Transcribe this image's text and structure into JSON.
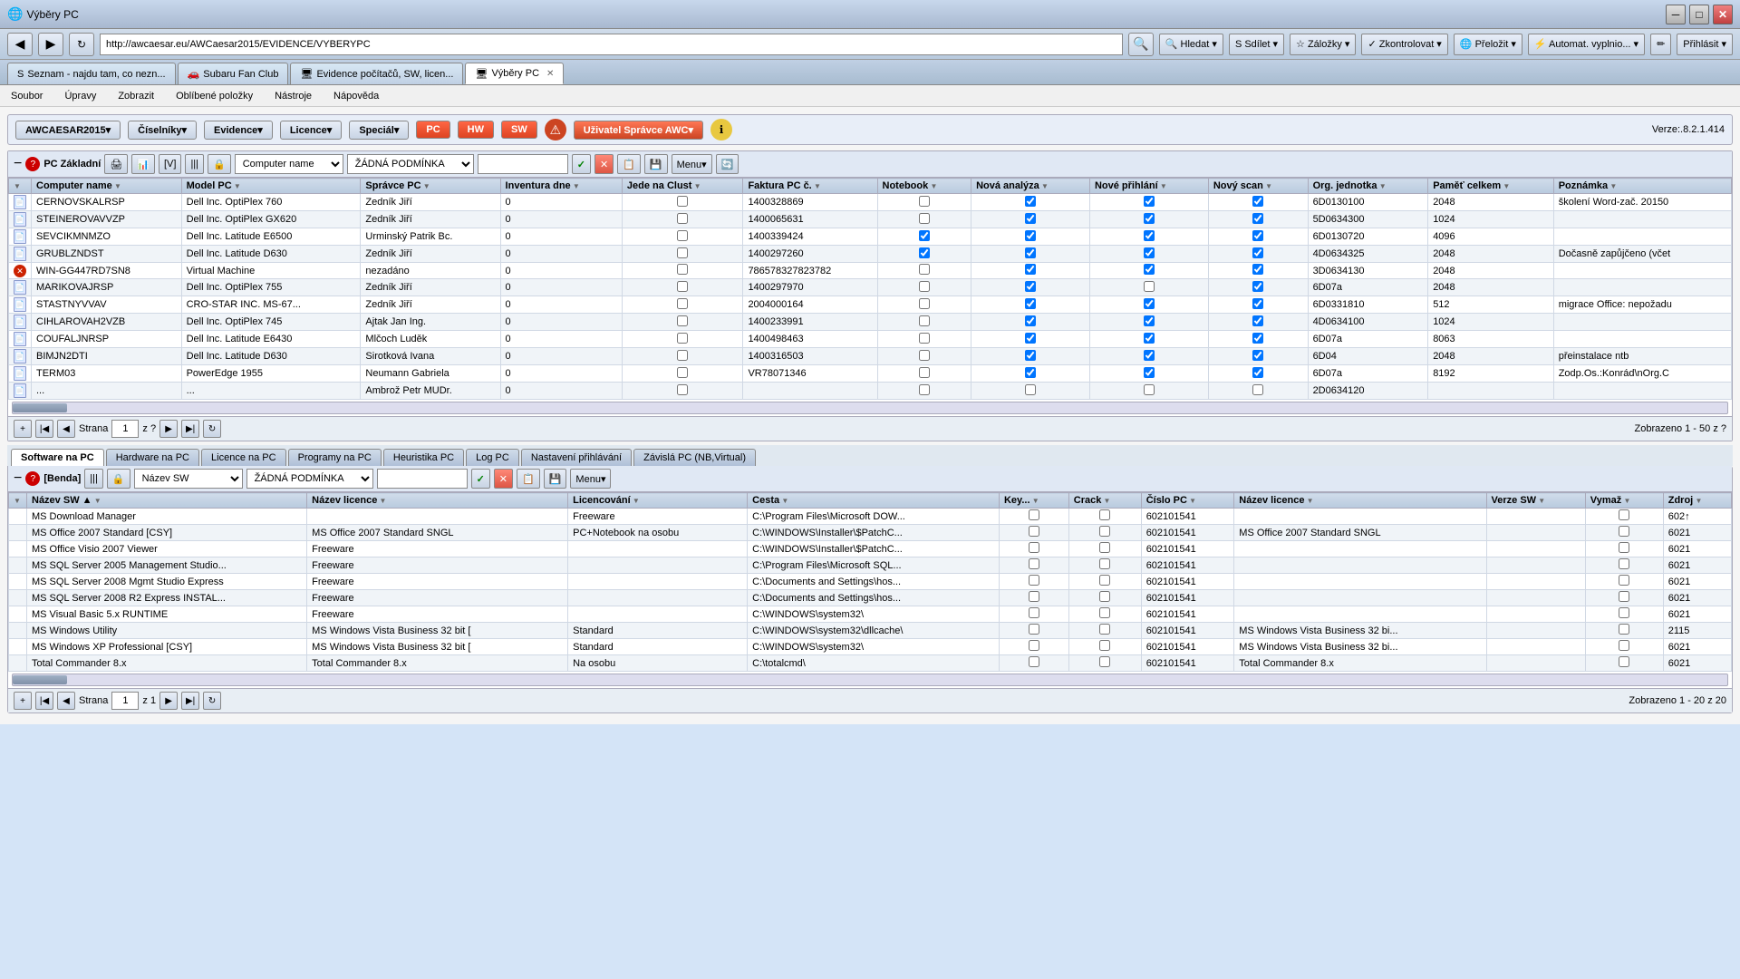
{
  "browser": {
    "titlebar": {
      "title": "Výběry PC"
    },
    "tabs": [
      {
        "label": "Seznam - najdu tam, co nezn...",
        "active": false
      },
      {
        "label": "Subaru Fan Club",
        "active": false
      },
      {
        "label": "Evidence počítačů, SW, licen...",
        "active": false
      },
      {
        "label": "Výběry PC",
        "active": true
      }
    ],
    "address": "http://awcaesar.eu/AWCaesar2015/EVIDENCE/VYBERYPC",
    "toolbar_items": [
      "Hledat ▾",
      "S Sdílet ▾",
      "☆ Záložky ▾",
      "✓ Zkontrolovat ▾",
      "Přeložit ▾",
      "Automat. vyplnio... ▾",
      "✏"
    ]
  },
  "menu_bar": [
    "Soubor",
    "Úpravy",
    "Zobrazit",
    "Oblíbené položky",
    "Nástroje",
    "Nápověda"
  ],
  "app_header": {
    "nav_items": [
      "AWCAESAR2015▾",
      "Číselníky▾",
      "Evidence▾",
      "Licence▾",
      "Speciál▾"
    ],
    "pc_label": "PC",
    "hw_label": "HW",
    "sw_label": "SW",
    "user_label": "Uživatel Správce AWC▾",
    "version_label": "Verze:.8.2.1.414"
  },
  "top_section": {
    "toolbar": {
      "icon_label": "PC Základní",
      "filter_field": "Computer name",
      "filter_condition": "ŽÁDNÁ PODMÍNKA",
      "menu_label": "Menu▾"
    },
    "columns": [
      "",
      "Computer name",
      "Model PC",
      "Správce PC",
      "Inventura dne",
      "Jede na Clust",
      "Faktura PC č.",
      "Notebook",
      "Nová analýza",
      "Nové přihlání",
      "Nový scan",
      "Org. jednotka",
      "Paměť celkem",
      "Poznámka"
    ],
    "rows": [
      {
        "icon": "📄",
        "computer_name": "CERNOVSKALRSP",
        "model": "Dell Inc. OptiPlex 760",
        "spravce": "Zedník Jiří",
        "inventura": "0",
        "clust": "",
        "faktura": "1400328869",
        "notebook": false,
        "analyza": true,
        "prihlani": true,
        "scan": true,
        "org": "6D0130100",
        "pamet": "2048",
        "poznamka": "školení Word-zač. 20150"
      },
      {
        "icon": "📄",
        "computer_name": "STEINEROVAVVZP",
        "model": "Dell Inc. OptiPlex GX620",
        "spravce": "Zedník Jiří",
        "inventura": "0",
        "clust": "",
        "faktura": "1400065631",
        "notebook": false,
        "analyza": true,
        "prihlani": true,
        "scan": true,
        "org": "5D0634300",
        "pamet": "1024",
        "poznamka": ""
      },
      {
        "icon": "📄",
        "computer_name": "SEVCIKMNMZO",
        "model": "Dell Inc. Latitude E6500",
        "spravce": "Urminský Patrik Bc.",
        "inventura": "0",
        "clust": "",
        "faktura": "1400339424",
        "notebook": true,
        "analyza": true,
        "prihlani": true,
        "scan": true,
        "org": "6D0130720",
        "pamet": "4096",
        "poznamka": ""
      },
      {
        "icon": "📄",
        "computer_name": "GRUBLZNDST",
        "model": "Dell Inc. Latitude D630",
        "spravce": "Zedník Jiří",
        "inventura": "0",
        "clust": "",
        "faktura": "1400297260",
        "notebook": true,
        "analyza": true,
        "prihlani": true,
        "scan": true,
        "org": "4D0634325",
        "pamet": "2048",
        "poznamka": "Dočasně zapůjčeno (včet"
      },
      {
        "icon": "❌",
        "computer_name": "WIN-GG447RD7SN8",
        "model": "Virtual Machine",
        "spravce": "nezadáno",
        "inventura": "0",
        "clust": "",
        "faktura": "786578327823782",
        "notebook": false,
        "analyza": true,
        "prihlani": true,
        "scan": true,
        "org": "3D0634130",
        "pamet": "2048",
        "poznamka": ""
      },
      {
        "icon": "📄",
        "computer_name": "MARIKOVAJRSP",
        "model": "Dell Inc. OptiPlex 755",
        "spravce": "Zedník Jiří",
        "inventura": "0",
        "clust": "",
        "faktura": "1400297970",
        "notebook": false,
        "analyza": true,
        "prihlani": false,
        "scan": true,
        "org": "6D07a",
        "pamet": "2048",
        "poznamka": ""
      },
      {
        "icon": "📄",
        "computer_name": "STASTNYVVAV",
        "model": "CRO-STAR INC. MS-67...",
        "spravce": "Zedník Jiří",
        "inventura": "0",
        "clust": "",
        "faktura": "2004000164",
        "notebook": false,
        "analyza": true,
        "prihlani": true,
        "scan": true,
        "org": "6D0331810",
        "pamet": "512",
        "poznamka": "migrace Office: nepožadu"
      },
      {
        "icon": "📄",
        "computer_name": "CIHLAROVAH2VZB",
        "model": "Dell Inc. OptiPlex 745",
        "spravce": "Ajtak Jan Ing.",
        "inventura": "0",
        "clust": "",
        "faktura": "1400233991",
        "notebook": false,
        "analyza": true,
        "prihlani": true,
        "scan": true,
        "org": "4D0634100",
        "pamet": "1024",
        "poznamka": ""
      },
      {
        "icon": "📄",
        "computer_name": "COUFALJNRSP",
        "model": "Dell Inc. Latitude E6430",
        "spravce": "Mlčoch Luděk",
        "inventura": "0",
        "clust": "",
        "faktura": "1400498463",
        "notebook": false,
        "analyza": true,
        "prihlani": true,
        "scan": true,
        "org": "6D07a",
        "pamet": "8063",
        "poznamka": ""
      },
      {
        "icon": "📄",
        "computer_name": "BIMJN2DTI",
        "model": "Dell Inc. Latitude D630",
        "spravce": "Sirotková Ivana",
        "inventura": "0",
        "clust": "",
        "faktura": "1400316503",
        "notebook": false,
        "analyza": true,
        "prihlani": true,
        "scan": true,
        "org": "6D04",
        "pamet": "2048",
        "poznamka": "přeinstalace ntb"
      },
      {
        "icon": "📄",
        "computer_name": "TERM03",
        "model": "PowerEdge 1955",
        "spravce": "Neumann Gabriela",
        "inventura": "0",
        "clust": "",
        "faktura": "VR78071346",
        "notebook": false,
        "analyza": true,
        "prihlani": true,
        "scan": true,
        "org": "6D07a",
        "pamet": "8192",
        "poznamka": "Zodp.Os.:Konrád\\nOrg.C"
      },
      {
        "icon": "📄",
        "computer_name": "...",
        "model": "...",
        "spravce": "Ambrož Petr MUDr.",
        "inventura": "0",
        "clust": "",
        "faktura": "",
        "notebook": false,
        "analyza": false,
        "prihlani": false,
        "scan": false,
        "org": "2D0634120",
        "pamet": "",
        "poznamka": ""
      }
    ],
    "pagination": {
      "page_label": "Strana",
      "page_num": "1",
      "of_label": "z ?",
      "showing": "Zobrazeno 1 - 50 z ?"
    }
  },
  "bottom_section": {
    "tabs": [
      "Software na PC",
      "Hardware na PC",
      "Licence na PC",
      "Programy na PC",
      "Heuristika PC",
      "Log PC",
      "Nastavení přihlávání",
      "Závislá PC (NB,Virtual)"
    ],
    "active_tab": "Software na PC",
    "toolbar": {
      "filter_label": "[Benda]",
      "filter_field": "Název SW",
      "filter_condition": "ŽÁDNÁ PODMÍNKA",
      "menu_label": "Menu▾"
    },
    "columns": [
      "Název SW ▲",
      "Název licence",
      "Licencování",
      "Cesta",
      "Key...",
      "Crack",
      "Číslo PC",
      "Název licence",
      "Verze SW",
      "Vymaž",
      "Zdroj"
    ],
    "rows": [
      {
        "nazev": "MS Download Manager",
        "nazev_lic": "",
        "licencovani": "Freeware",
        "cesta": "C:\\Program Files\\Microsoft DOW...",
        "key": false,
        "crack": false,
        "cislo": "602101541",
        "lic_name": "",
        "verze": "",
        "vymaz": false,
        "zdroj": "602↑"
      },
      {
        "nazev": "MS Office 2007 Standard [CSY]",
        "nazev_lic": "MS Office 2007 Standard SNGL",
        "licencovani": "PC+Notebook na osobu",
        "cesta": "C:\\WINDOWS\\Installer\\$PatchC...",
        "key": false,
        "crack": false,
        "cislo": "602101541",
        "lic_name": "MS Office 2007 Standard SNGL",
        "verze": "",
        "vymaz": false,
        "zdroj": "6021"
      },
      {
        "nazev": "MS Office Visio 2007 Viewer",
        "nazev_lic": "Freeware",
        "licencovani": "",
        "cesta": "C:\\WINDOWS\\Installer\\$PatchC...",
        "key": false,
        "crack": false,
        "cislo": "602101541",
        "lic_name": "",
        "verze": "",
        "vymaz": false,
        "zdroj": "6021"
      },
      {
        "nazev": "MS SQL Server 2005 Management Studio...",
        "nazev_lic": "Freeware",
        "licencovani": "",
        "cesta": "C:\\Program Files\\Microsoft SQL...",
        "key": false,
        "crack": false,
        "cislo": "602101541",
        "lic_name": "",
        "verze": "",
        "vymaz": false,
        "zdroj": "6021"
      },
      {
        "nazev": "MS SQL Server 2008 Mgmt Studio Express",
        "nazev_lic": "Freeware",
        "licencovani": "",
        "cesta": "C:\\Documents and Settings\\hos...",
        "key": false,
        "crack": false,
        "cislo": "602101541",
        "lic_name": "",
        "verze": "",
        "vymaz": false,
        "zdroj": "6021"
      },
      {
        "nazev": "MS SQL Server 2008 R2 Express INSTAL...",
        "nazev_lic": "Freeware",
        "licencovani": "",
        "cesta": "C:\\Documents and Settings\\hos...",
        "key": false,
        "crack": false,
        "cislo": "602101541",
        "lic_name": "",
        "verze": "",
        "vymaz": false,
        "zdroj": "6021"
      },
      {
        "nazev": "MS Visual Basic 5.x RUNTIME",
        "nazev_lic": "Freeware",
        "licencovani": "",
        "cesta": "C:\\WINDOWS\\system32\\",
        "key": false,
        "crack": false,
        "cislo": "602101541",
        "lic_name": "",
        "verze": "",
        "vymaz": false,
        "zdroj": "6021"
      },
      {
        "nazev": "MS Windows Utility",
        "nazev_lic": "MS Windows Vista Business 32 bit [",
        "licencovani": "Standard",
        "cesta": "C:\\WINDOWS\\system32\\dllcache\\",
        "key": false,
        "crack": false,
        "cislo": "602101541",
        "lic_name": "MS Windows Vista Business 32 bi...",
        "verze": "",
        "vymaz": false,
        "zdroj": "2115"
      },
      {
        "nazev": "MS Windows XP Professional [CSY]",
        "nazev_lic": "MS Windows Vista Business 32 bit [",
        "licencovani": "Standard",
        "cesta": "C:\\WINDOWS\\system32\\",
        "key": false,
        "crack": false,
        "cislo": "602101541",
        "lic_name": "MS Windows Vista Business 32 bi...",
        "verze": "",
        "vymaz": false,
        "zdroj": "6021"
      },
      {
        "nazev": "Total Commander 8.x",
        "nazev_lic": "Total Commander 8.x",
        "licencovani": "Na osobu",
        "cesta": "C:\\totalcmd\\",
        "key": false,
        "crack": false,
        "cislo": "602101541",
        "lic_name": "Total Commander 8.x",
        "verze": "",
        "vymaz": false,
        "zdroj": "6021"
      }
    ],
    "pagination": {
      "page_label": "Strana",
      "page_num": "1",
      "of_label": "z 1",
      "showing": "Zobrazeno 1 - 20 z 20"
    }
  }
}
